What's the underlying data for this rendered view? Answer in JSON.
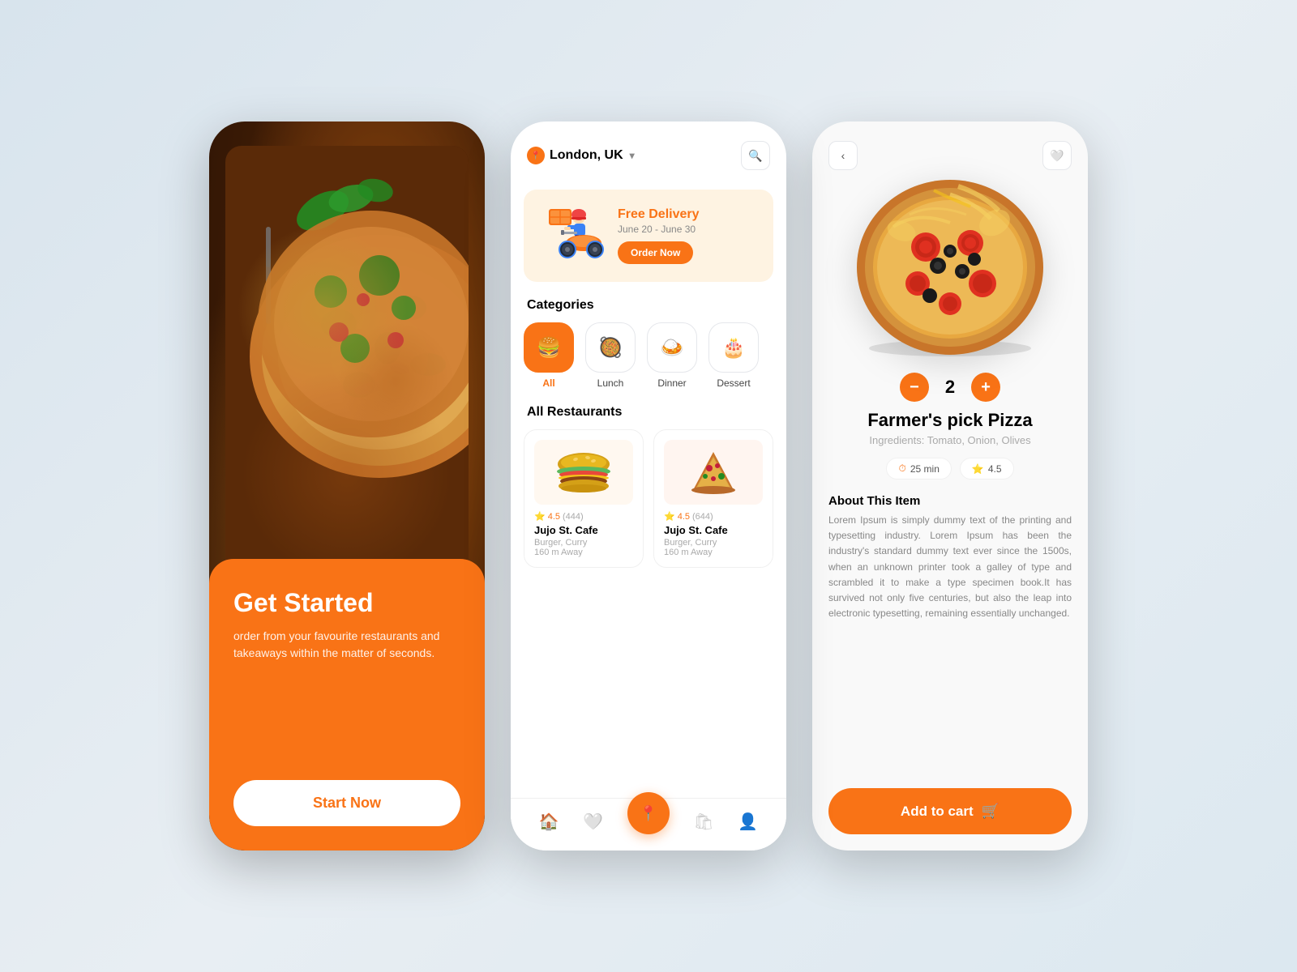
{
  "phone1": {
    "title": "Get Started",
    "subtitle": "order from your favourite restaurants and takeaways within the matter of seconds.",
    "cta_label": "Start Now"
  },
  "phone2": {
    "header": {
      "location": "London, UK",
      "location_icon": "📍",
      "search_icon": "🔍"
    },
    "banner": {
      "title": "Free Delivery",
      "dates": "June 20 - June 30",
      "cta": "Order Now"
    },
    "categories": {
      "label": "Categories",
      "items": [
        {
          "id": "all",
          "name": "All",
          "icon": "🍔",
          "active": true
        },
        {
          "id": "lunch",
          "name": "Lunch",
          "icon": "🥘",
          "active": false
        },
        {
          "id": "dinner",
          "name": "Dinner",
          "icon": "🍛",
          "active": false
        },
        {
          "id": "dessert",
          "name": "Dessert",
          "icon": "🎂",
          "active": false
        }
      ]
    },
    "restaurants": {
      "label": "All Restaurants",
      "items": [
        {
          "name": "Jujo St. Cafe",
          "type": "Burger, Curry",
          "distance": "160 m Away",
          "rating": "4.5",
          "reviews": "444"
        },
        {
          "name": "Jujo St. Cafe",
          "type": "Burger, Curry",
          "distance": "160 m Away",
          "rating": "4.5",
          "reviews": "644"
        }
      ]
    },
    "nav": {
      "items": [
        "home",
        "heart",
        "location",
        "bag",
        "user"
      ]
    }
  },
  "phone3": {
    "item_name": "Farmer's pick Pizza",
    "ingredients": "Ingredients: Tomato, Onion, Olives",
    "quantity": 2,
    "tags": [
      {
        "label": "25 min",
        "icon": "⏱"
      },
      {
        "label": "4.5",
        "icon": "⭐"
      }
    ],
    "about_title": "About This Item",
    "about_text": "Lorem Ipsum is simply dummy text of the printing and typesetting industry. Lorem Ipsum has been the industry's standard dummy text ever since the 1500s, when an unknown printer took a galley of type and scrambled it to make a type specimen book.It has survived not only five centuries, but also the leap into electronic typesetting, remaining essentially unchanged.",
    "add_to_cart_label": "Add to cart"
  }
}
